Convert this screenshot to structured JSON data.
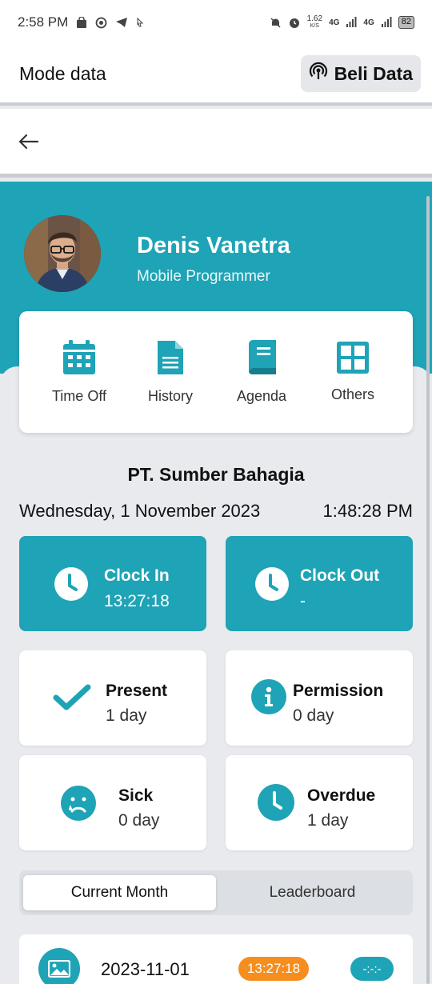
{
  "status_bar": {
    "time": "2:58 PM",
    "net_speed": "1.62",
    "net_unit": "K/S",
    "signal_1": "4G",
    "signal_2": "4G",
    "battery": "82"
  },
  "mode_bar": {
    "title": "Mode data",
    "buy_label": "Beli Data"
  },
  "profile": {
    "name": "Denis Vanetra",
    "role": "Mobile Programmer"
  },
  "menu": [
    {
      "label": "Time Off",
      "icon": "calendar-icon"
    },
    {
      "label": "History",
      "icon": "document-icon"
    },
    {
      "label": "Agenda",
      "icon": "book-icon"
    },
    {
      "label": "Others",
      "icon": "grid-icon"
    }
  ],
  "company": "PT. Sumber Bahagia",
  "date": "Wednesday, 1 November 2023",
  "time": "1:48:28 PM",
  "clock_in": {
    "title": "Clock In",
    "value": "13:27:18"
  },
  "clock_out": {
    "title": "Clock Out",
    "value": "-"
  },
  "stats": [
    {
      "title": "Present",
      "value": "1 day",
      "icon": "check-icon"
    },
    {
      "title": "Permission",
      "value": "0 day",
      "icon": "info-icon"
    },
    {
      "title": "Sick",
      "value": "0 day",
      "icon": "sad-face-icon"
    },
    {
      "title": "Overdue",
      "value": "1 day",
      "icon": "clock-icon"
    }
  ],
  "tabs": [
    {
      "label": "Current Month",
      "active": true
    },
    {
      "label": "Leaderboard",
      "active": false
    }
  ],
  "history": [
    {
      "date": "2023-11-01",
      "clock_in": "13:27:18",
      "clock_out": "-:-:-"
    }
  ],
  "colors": {
    "primary": "#1fa3b6",
    "accent_orange": "#f58e1f",
    "background": "#e8eaee"
  }
}
